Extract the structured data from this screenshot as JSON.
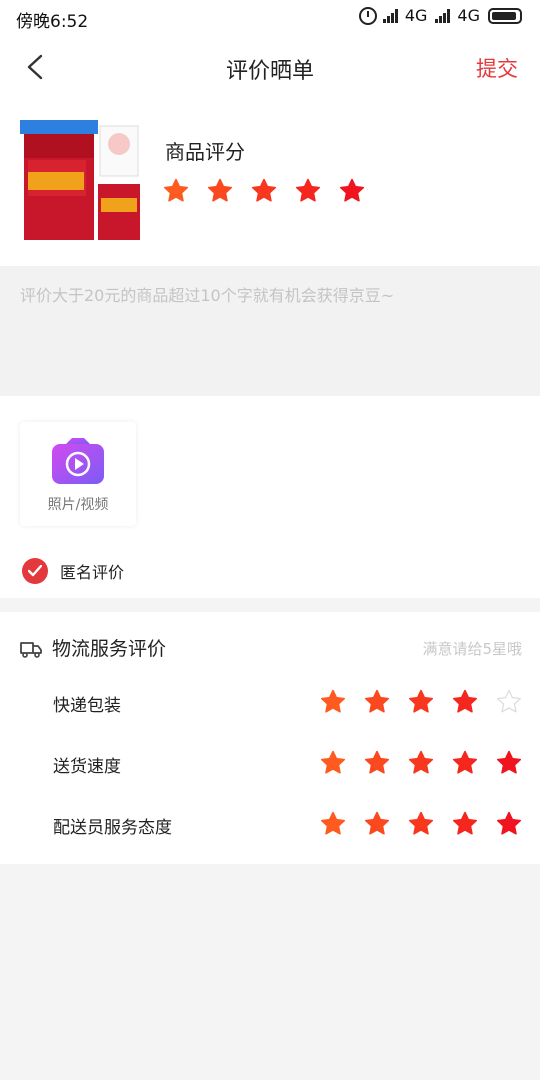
{
  "status_bar": {
    "time": "傍晚6:52",
    "network1": "4G",
    "network2": "4G"
  },
  "header": {
    "title": "评价晒单",
    "submit_label": "提交"
  },
  "product": {
    "rating_title": "商品评分",
    "rating": 5
  },
  "review": {
    "placeholder": "评价大于20元的商品超过10个字就有机会获得京豆~"
  },
  "media": {
    "upload_label": "照片/视频"
  },
  "anonymous": {
    "label": "匿名评价",
    "checked": true
  },
  "logistics": {
    "title": "物流服务评价",
    "hint": "满意请给5星哦",
    "rows": [
      {
        "label": "快递包装",
        "rating": 4
      },
      {
        "label": "送货速度",
        "rating": 5
      },
      {
        "label": "配送员服务态度",
        "rating": 5
      }
    ]
  },
  "colors": {
    "accent": "#e4393c",
    "star_start": "#ff5a1f",
    "star_end": "#f0141e",
    "star_empty": "#dddddd"
  }
}
